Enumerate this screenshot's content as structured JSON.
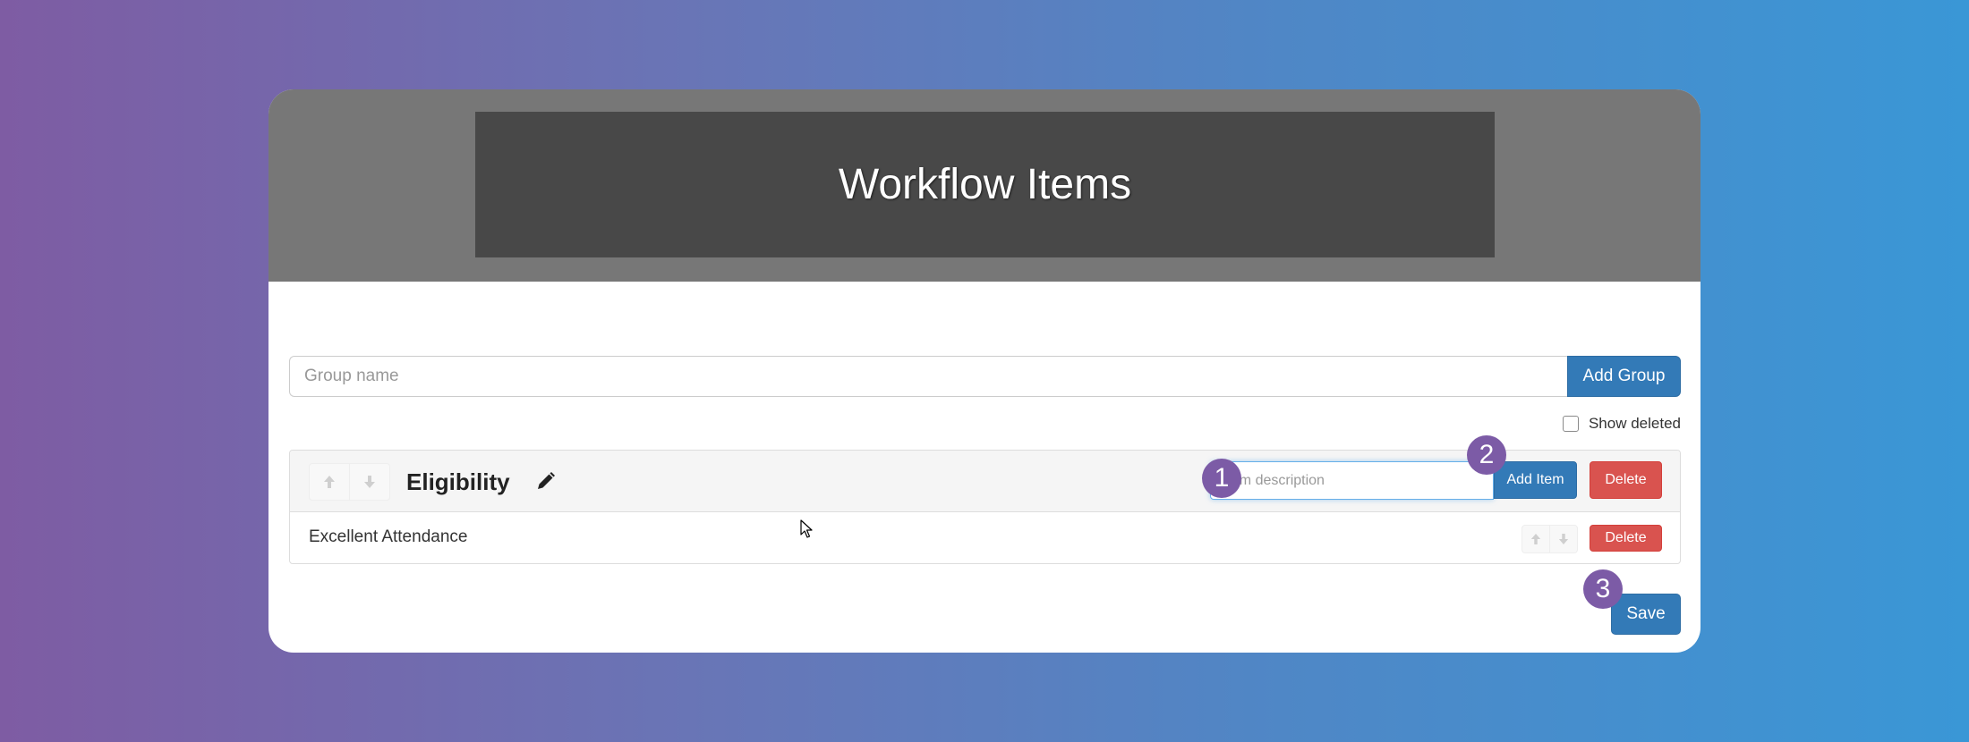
{
  "header": {
    "title": "Workflow Items"
  },
  "group_form": {
    "placeholder": "Group name",
    "value": "",
    "add_label": "Add Group"
  },
  "show_deleted": {
    "label": "Show deleted",
    "checked": false
  },
  "group": {
    "title": "Eligibility",
    "item_placeholder": "Item description",
    "add_item_label": "Add Item",
    "delete_label": "Delete",
    "items": [
      {
        "label": "Excellent Attendance",
        "delete_label": "Delete"
      }
    ]
  },
  "save_label": "Save",
  "markers": [
    "1",
    "2",
    "3"
  ],
  "colors": {
    "primary": "#337ab7",
    "danger": "#d9534f",
    "marker": "#7c5ba6",
    "header_bg": "#777777",
    "banner_bg": "#484848"
  },
  "icons": {
    "up": "arrow-up-icon",
    "down": "arrow-down-icon",
    "edit": "pencil-icon"
  }
}
